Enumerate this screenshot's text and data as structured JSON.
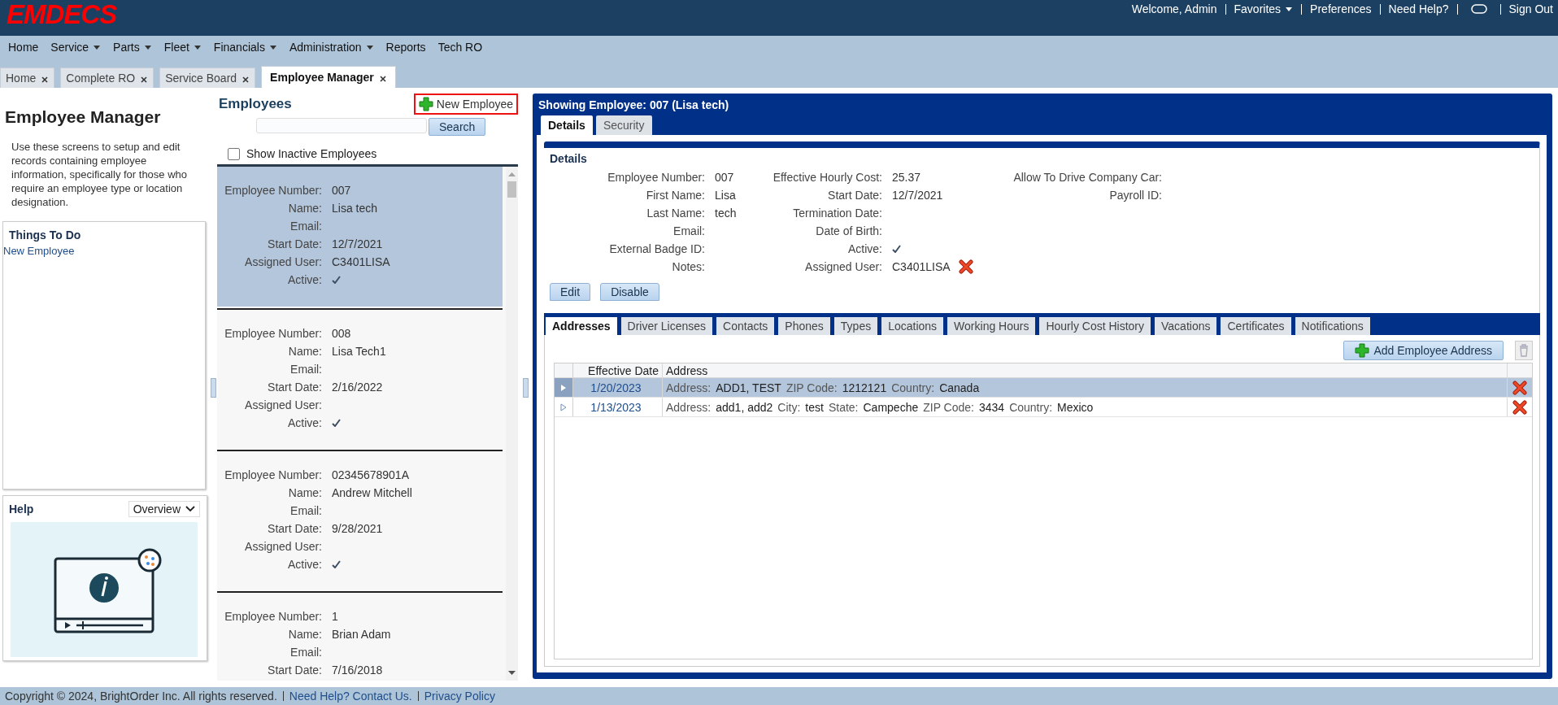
{
  "header": {
    "logo": "EMDECS",
    "links": [
      {
        "kind": "text",
        "label": "Welcome, Admin"
      },
      {
        "kind": "dropdown",
        "label": "Favorites"
      },
      {
        "kind": "link",
        "label": "Preferences"
      },
      {
        "kind": "link",
        "label": "Need Help?"
      },
      {
        "kind": "icon"
      },
      {
        "kind": "link",
        "label": "Sign Out"
      }
    ]
  },
  "nav": [
    {
      "label": "Home",
      "dropdown": false
    },
    {
      "label": "Service",
      "dropdown": true
    },
    {
      "label": "Parts",
      "dropdown": true
    },
    {
      "label": "Fleet",
      "dropdown": true
    },
    {
      "label": "Financials",
      "dropdown": true
    },
    {
      "label": "Administration",
      "dropdown": true
    },
    {
      "label": "Reports",
      "dropdown": false
    },
    {
      "label": "Tech RO",
      "dropdown": false
    }
  ],
  "tabs": [
    {
      "label": "Home",
      "selected": false
    },
    {
      "label": "Complete RO",
      "selected": false
    },
    {
      "label": "Service Board",
      "selected": false
    },
    {
      "label": "Employee Manager",
      "selected": true
    }
  ],
  "page": {
    "title": "Employee Manager",
    "description": "Use these screens to setup and edit records containing employee information, specifically for those who require an employee type or location designation.",
    "things_to_do": {
      "title": "Things To Do",
      "items": [
        "New Employee"
      ]
    },
    "help": {
      "title": "Help",
      "select": "Overview"
    }
  },
  "employees": {
    "title": "Employees",
    "new_button": "New Employee",
    "search_button": "Search",
    "show_inactive": {
      "label": "Show Inactive Employees",
      "checked": false
    },
    "records": [
      {
        "selected": true,
        "fields": [
          {
            "label": "Employee Number:",
            "value": "007"
          },
          {
            "label": "Name:",
            "value": "Lisa tech"
          },
          {
            "label": "Email:"
          },
          {
            "label": "Start Date:",
            "value": "12/7/2021"
          },
          {
            "label": "Assigned User:",
            "value": "C3401LISA"
          },
          {
            "label": "Active:",
            "checked": true
          }
        ]
      },
      {
        "selected": false,
        "fields": [
          {
            "label": "Employee Number:",
            "value": "008"
          },
          {
            "label": "Name:",
            "value": "Lisa Tech1"
          },
          {
            "label": "Email:"
          },
          {
            "label": "Start Date:",
            "value": "2/16/2022"
          },
          {
            "label": "Assigned User:"
          },
          {
            "label": "Active:",
            "checked": true
          }
        ]
      },
      {
        "selected": false,
        "fields": [
          {
            "label": "Employee Number:",
            "value": "02345678901A"
          },
          {
            "label": "Name:",
            "value": "Andrew Mitchell"
          },
          {
            "label": "Email:"
          },
          {
            "label": "Start Date:",
            "value": "9/28/2021"
          },
          {
            "label": "Assigned User:"
          },
          {
            "label": "Active:",
            "checked": true
          }
        ]
      },
      {
        "selected": false,
        "fields": [
          {
            "label": "Employee Number:",
            "value": "1"
          },
          {
            "label": "Name:",
            "value": "Brian Adam"
          },
          {
            "label": "Email:"
          },
          {
            "label": "Start Date:",
            "value": "7/16/2018"
          }
        ]
      }
    ]
  },
  "detail": {
    "title": "Showing Employee: 007 (Lisa tech)",
    "tabs": [
      {
        "label": "Details",
        "selected": true
      },
      {
        "label": "Security",
        "selected": false
      }
    ],
    "section_title": "Details",
    "columns": [
      [
        {
          "label": "Employee Number:",
          "value": "007"
        },
        {
          "label": "First Name:",
          "value": "Lisa"
        },
        {
          "label": "Last Name:",
          "value": "tech"
        },
        {
          "label": "Email:"
        },
        {
          "label": "External Badge ID:"
        },
        {
          "label": "Notes:"
        }
      ],
      [
        {
          "label": "Effective Hourly Cost:",
          "value": "25.37"
        },
        {
          "label": "Start Date:",
          "value": "12/7/2021"
        },
        {
          "label": "Termination Date:"
        },
        {
          "label": "Date of Birth:"
        },
        {
          "label": "Active:",
          "checked": true
        },
        {
          "label": "Assigned User:",
          "value": "C3401LISA",
          "removable": true
        }
      ],
      [
        {
          "label": "Allow To Drive Company Car:"
        },
        {
          "label": "Payroll ID:"
        }
      ]
    ],
    "buttons": [
      "Edit",
      "Disable"
    ],
    "subtabs": [
      {
        "label": "Addresses",
        "selected": true
      },
      {
        "label": "Driver Licenses",
        "selected": false
      },
      {
        "label": "Contacts",
        "selected": false
      },
      {
        "label": "Phones",
        "selected": false
      },
      {
        "label": "Types",
        "selected": false
      },
      {
        "label": "Locations",
        "selected": false
      },
      {
        "label": "Working Hours",
        "selected": false
      },
      {
        "label": "Hourly Cost History",
        "selected": false
      },
      {
        "label": "Vacations",
        "selected": false
      },
      {
        "label": "Certificates",
        "selected": false
      },
      {
        "label": "Notifications",
        "selected": false
      }
    ],
    "add_button": "Add Employee Address",
    "table": {
      "columns": [
        "Effective Date",
        "Address"
      ],
      "rows": [
        {
          "selected": true,
          "date": "1/20/2023",
          "parts": [
            {
              "label": "Address:",
              "value": "ADD1, TEST"
            },
            {
              "label": "ZIP Code:",
              "value": "1212121"
            },
            {
              "label": "Country:",
              "value": "Canada"
            }
          ]
        },
        {
          "selected": false,
          "date": "1/13/2023",
          "parts": [
            {
              "label": "Address:",
              "value": "add1, add2"
            },
            {
              "label": "City:",
              "value": "test"
            },
            {
              "label": "State:",
              "value": "Campeche"
            },
            {
              "label": "ZIP Code:",
              "value": "3434"
            },
            {
              "label": "Country:",
              "value": "Mexico"
            }
          ]
        }
      ]
    }
  },
  "footer": {
    "copyright": "Copyright © 2024, BrightOrder Inc. All rights reserved.",
    "links": [
      "Need Help? Contact Us.",
      "Privacy Policy"
    ]
  }
}
